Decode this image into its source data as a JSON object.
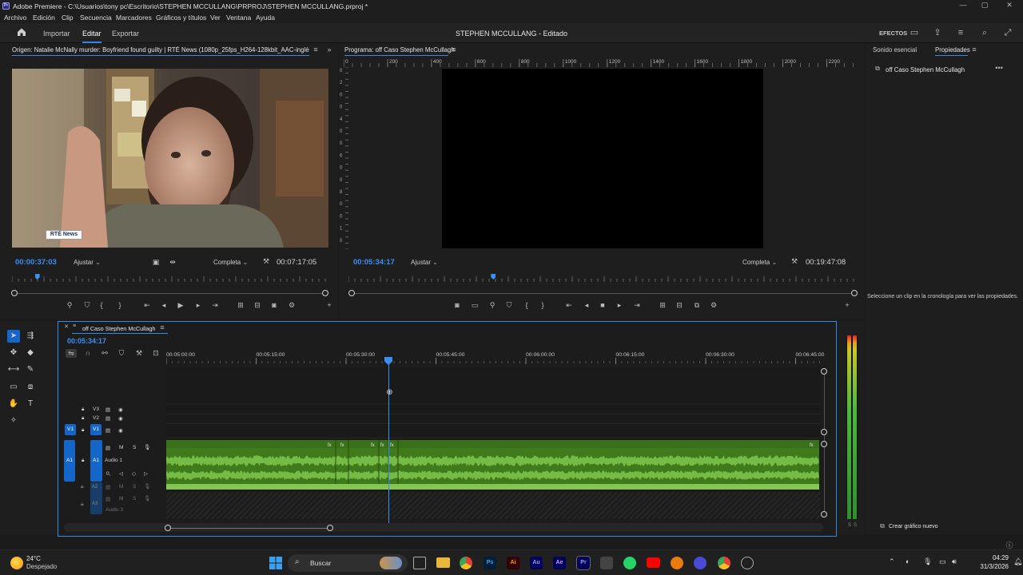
{
  "window": {
    "app_title": "Adobe Premiere - C:\\Usuarios\\tony pc\\Escritorio\\STEPHEN MCCULLANG\\PRPROJ\\STEPHEN MCCULLANG.prproj *",
    "minimize": "—",
    "maximize": "▢",
    "close": "✕"
  },
  "menu": [
    "Archivo",
    "Edición",
    "Clip",
    "Secuencia",
    "Marcadores",
    "Gráficos y títulos",
    "Ver",
    "Ventana",
    "Ayuda"
  ],
  "header": {
    "tabs": [
      "Importar",
      "Editar",
      "Exportar"
    ],
    "active_tab": "Editar",
    "project_title": "STEPHEN MCCULLANG - Editado",
    "effects_label": "EFECTOS"
  },
  "source_monitor": {
    "title": "Origen: Natalie McNally murder: Boyfriend found guilty | RTÉ News (1080p_25fps_H264-128kbit_AAC-inglés).mp4",
    "timecode": "00:00:37:03",
    "fit": "Ajustar",
    "resolution": "Completa",
    "duration": "00:07:17:05",
    "watermark": "RTÉ News",
    "playhead_fraction": 0.08
  },
  "program_monitor": {
    "title": "Programa: off Caso Stephen McCullagh",
    "timecode": "00:05:34:17",
    "fit": "Ajustar",
    "resolution": "Completa",
    "duration": "00:19:47:08",
    "ruler": [
      "0",
      "200",
      "400",
      "600",
      "800",
      "1000",
      "1200",
      "1400",
      "1600",
      "1800",
      "2000",
      "2200"
    ],
    "vruler": [
      "0",
      "2",
      "0",
      "0",
      "4",
      "0",
      "0",
      "6",
      "0",
      "0",
      "8",
      "0",
      "0",
      "1",
      "0"
    ],
    "playhead_fraction": 0.285
  },
  "properties_panel": {
    "tabs": [
      "Sonido esencial",
      "Propiedades"
    ],
    "active_tab": "Propiedades",
    "sequence_name": "off Caso Stephen McCullagh",
    "hint": "Seleccione un clip en la cronología para ver las propiedades.",
    "create_graphic": "Crear gráfico nuevo"
  },
  "timeline": {
    "sequence_tab": "off Caso Stephen McCullagh",
    "timecode": "00:05:34:17",
    "ruler": [
      "00:05:00:00",
      "00:05:15:00",
      "00:05:30:00",
      "00:05:45:00",
      "00:06:00:00",
      "00:06:15:00",
      "00:06:30:00",
      "00:06:45:00"
    ],
    "video_tracks": [
      "V3",
      "V2",
      "V1"
    ],
    "audio_tracks": [
      {
        "id": "A1",
        "name": "Audio 1"
      },
      {
        "id": "A2",
        "name": ""
      },
      {
        "id": "A3",
        "name": "Audio 3"
      }
    ],
    "source_patch_v": "V1",
    "source_patch_a": "A1",
    "audio_controls": {
      "mute": "M",
      "solo": "S",
      "volume": "0,"
    },
    "meter_labels": [
      "S",
      "S"
    ]
  },
  "taskbar": {
    "temperature": "24°C",
    "weather": "Despejado",
    "search": "Buscar",
    "time": "04:29",
    "date": "31/3/2026",
    "apps": [
      "Ps",
      "Ai",
      "Au",
      "Ae",
      "Pr"
    ]
  },
  "colors": {
    "accent_blue": "#2d8ceb",
    "timecode_blue": "#3a8ff7",
    "audio_green": "#7cc24a",
    "audio_clip_bg": "#3f7a1c",
    "track_blue": "#1467c8"
  }
}
